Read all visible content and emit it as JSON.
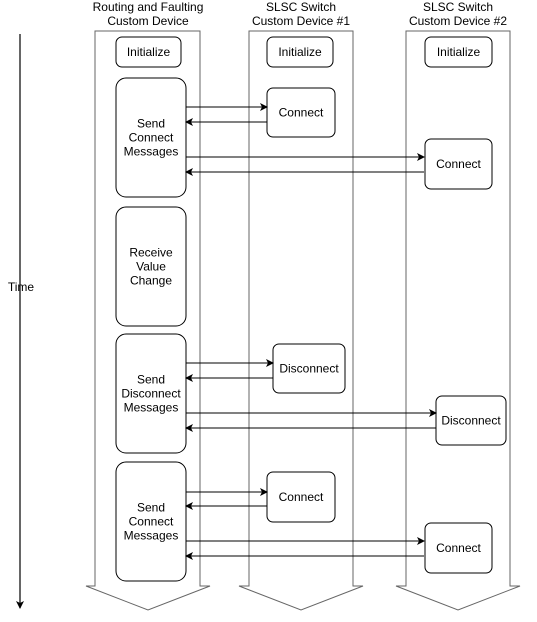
{
  "time_axis": {
    "label": "Time"
  },
  "lanes": [
    {
      "title_line1": "Routing and Faulting",
      "title_line2": "Custom Device"
    },
    {
      "title_line1": "SLSC Switch",
      "title_line2": "Custom Device #1"
    },
    {
      "title_line1": "SLSC Switch",
      "title_line2": "Custom Device #2"
    }
  ],
  "steps": {
    "lane1": [
      {
        "lines": [
          "Initialize"
        ]
      },
      {
        "lines": [
          "Send",
          "Connect",
          "Messages"
        ]
      },
      {
        "lines": [
          "Receive",
          "Value",
          "Change"
        ]
      },
      {
        "lines": [
          "Send",
          "Disconnect",
          "Messages"
        ]
      },
      {
        "lines": [
          "Send",
          "Connect",
          "Messages"
        ]
      }
    ],
    "lane2": [
      {
        "lines": [
          "Initialize"
        ]
      },
      {
        "lines": [
          "Connect"
        ]
      },
      {
        "lines": [
          "Disconnect"
        ]
      },
      {
        "lines": [
          "Connect"
        ]
      }
    ],
    "lane3": [
      {
        "lines": [
          "Initialize"
        ]
      },
      {
        "lines": [
          "Connect"
        ]
      },
      {
        "lines": [
          "Disconnect"
        ]
      },
      {
        "lines": [
          "Connect"
        ]
      }
    ]
  }
}
